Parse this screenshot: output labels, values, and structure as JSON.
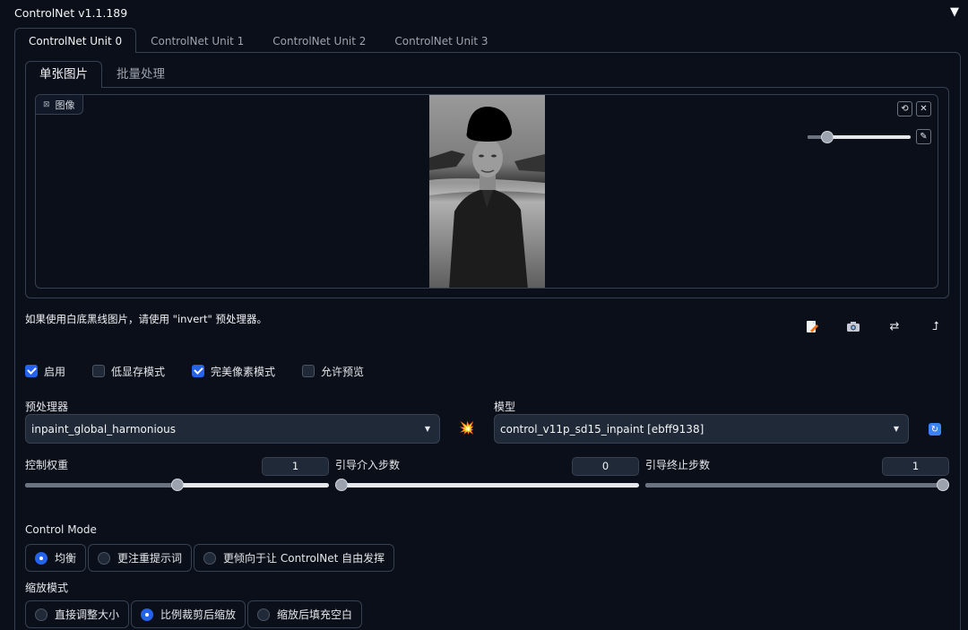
{
  "header": {
    "title": "ControlNet v1.1.189",
    "toggle_icon": "▼"
  },
  "unit_tabs": [
    "ControlNet Unit 0",
    "ControlNet Unit 1",
    "ControlNet Unit 2",
    "ControlNet Unit 3"
  ],
  "image_tabs": [
    "单张图片",
    "批量处理"
  ],
  "image_panel": {
    "label": "图像"
  },
  "hint": "如果使用白底黑线图片，请使用 \"invert\" 预处理器。",
  "checkboxes": [
    {
      "label": "启用",
      "checked": true
    },
    {
      "label": "低显存模式",
      "checked": false
    },
    {
      "label": "完美像素模式",
      "checked": true
    },
    {
      "label": "允许预览",
      "checked": false
    }
  ],
  "preprocessor": {
    "label": "预处理器",
    "value": "inpaint_global_harmonious"
  },
  "model": {
    "label": "模型",
    "value": "control_v11p_sd15_inpaint [ebff9138]"
  },
  "sliders": {
    "weight": {
      "label": "控制权重",
      "value": "1",
      "fraction": 0.5
    },
    "start": {
      "label": "引导介入步数",
      "value": "0",
      "fraction": 0.0
    },
    "end": {
      "label": "引导终止步数",
      "value": "1",
      "fraction": 1.0
    }
  },
  "brush_size_fraction": 0.15,
  "control_mode": {
    "label": "Control Mode",
    "options": [
      "均衡",
      "更注重提示词",
      "更倾向于让 ControlNet 自由发挥"
    ],
    "selected": 0
  },
  "resize_mode": {
    "label": "缩放模式",
    "options": [
      "直接调整大小",
      "比例裁剪后缩放",
      "缩放后填充空白"
    ],
    "selected": 1
  },
  "colors": {
    "accent": "#2563eb",
    "background": "#0b0f19",
    "border": "#374151"
  }
}
